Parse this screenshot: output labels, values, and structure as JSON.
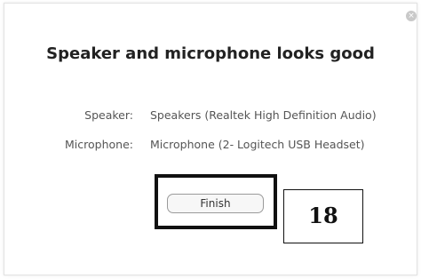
{
  "dialog": {
    "close_symbol": "×",
    "title": "Speaker and microphone looks good",
    "rows": [
      {
        "label": "Speaker:",
        "value": "Speakers (Realtek High Definition Audio)"
      },
      {
        "label": "Microphone:",
        "value": "Microphone (2- Logitech USB Headset)"
      }
    ],
    "finish_label": "Finish"
  },
  "annotation": {
    "step_number": "18"
  }
}
